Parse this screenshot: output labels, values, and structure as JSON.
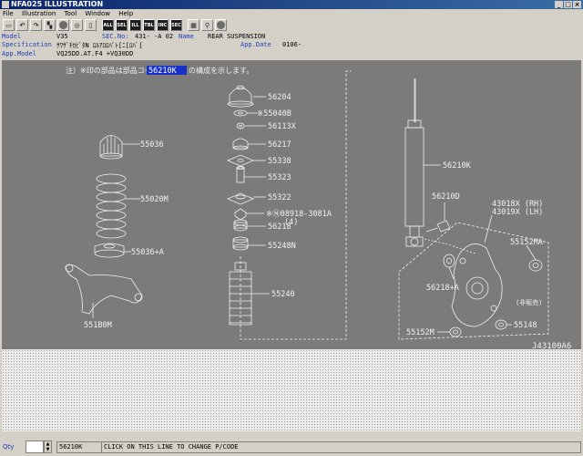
{
  "window": {
    "title": "NFA025 ILLUSTRATION"
  },
  "menu": [
    "File",
    "Illustration",
    "Tool",
    "Window",
    "Help"
  ],
  "toolbar": [
    {
      "icon": "print-icon",
      "glyph": "▭"
    },
    {
      "icon": "undo-icon",
      "glyph": "↶"
    },
    {
      "icon": "redo-icon",
      "glyph": "↷"
    },
    {
      "icon": "pointer-icon",
      "glyph": "▚"
    },
    {
      "icon": "disc-icon",
      "glyph": "●"
    },
    {
      "icon": "zoom-icon",
      "glyph": "◎"
    },
    {
      "icon": "catalog-icon",
      "glyph": "▯"
    },
    {
      "icon": "list-all-icon",
      "glyph": "ALL"
    },
    {
      "icon": "list-sel-icon",
      "glyph": "SEL"
    },
    {
      "icon": "list-ill-icon",
      "glyph": "ILL"
    },
    {
      "icon": "list-tbl-icon",
      "glyph": "TBL"
    },
    {
      "icon": "list-inc-icon",
      "glyph": "INC"
    },
    {
      "icon": "list-sec-icon",
      "glyph": "SEC"
    },
    {
      "icon": "grid-icon",
      "glyph": "▦"
    },
    {
      "icon": "lamp-icon",
      "glyph": "⚲"
    },
    {
      "icon": "stop-icon",
      "glyph": "●"
    }
  ],
  "info": {
    "model_label": "Model",
    "model_value": "V35",
    "sec_label": "SEC.No:",
    "sec_value": "431-  -A 02",
    "name_label": "Name",
    "name_value": "REAR SUSPENSION",
    "spec_label": "Specification",
    "spec_value": "ｻﾜｻﾞﾁｶﾋﾞﾀN ﾛﾙｱﾛﾛﾊﾟﾄ[ﾆ[ﾛﾊﾞ[",
    "appdate_label": "App.Date",
    "appdate_value": "0106-",
    "appmodel_label": "App.Model",
    "appmodel_value": "VQ25DD.AT.F4 +VQ30DD"
  },
  "note": {
    "prefix": "注）※印の部品は部品コード",
    "highlight": "56210K",
    "suffix": "の構成を示します。"
  },
  "diagram": {
    "part_labels": [
      "55036",
      "55020M",
      "55036+A",
      "551B0M",
      "56204",
      "※55040B",
      "56113X",
      "56217",
      "55338",
      "55323",
      "55322",
      "※Ⓝ08918-3081A",
      "(4)",
      "56218",
      "55248N",
      "55240",
      "56210K",
      "56210D",
      "43018X (RH)",
      "43019X (LH)",
      "55152MA",
      "56218+A",
      "(非販売)",
      "55152M",
      "55148"
    ],
    "figure_code": "J43100A6"
  },
  "status": {
    "qty_label": "Qty",
    "code_value": "56210K",
    "message": "CLICK ON THIS LINE TO CHANGE P/CODE"
  }
}
